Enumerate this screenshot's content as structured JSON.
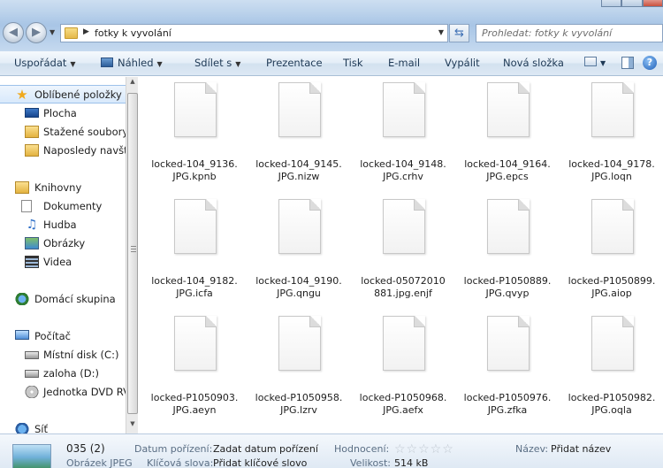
{
  "address": {
    "path": "fotky k vyvolání",
    "search_placeholder": "Prohledat: fotky k vyvolání"
  },
  "toolbar": {
    "organize": "Uspořádat",
    "preview": "Náhled",
    "share": "Sdílet s",
    "slideshow": "Prezentace",
    "print": "Tisk",
    "email": "E-mail",
    "burn": "Vypálit",
    "new_folder": "Nová složka"
  },
  "sidebar": {
    "favorites": "Oblíbené položky",
    "desktop": "Plocha",
    "downloads": "Stažené soubory",
    "recent": "Naposledy navšti",
    "libraries": "Knihovny",
    "documents": "Dokumenty",
    "music": "Hudba",
    "pictures": "Obrázky",
    "videos": "Videa",
    "homegroup": "Domácí skupina",
    "computer": "Počítač",
    "local_disk": "Místní disk (C:)",
    "backup": "zaloha (D:)",
    "dvd": "Jednotka DVD RV",
    "network": "Síť"
  },
  "files": [
    {
      "line1": "locked-104_9136.",
      "line2": "JPG.kpnb"
    },
    {
      "line1": "locked-104_9145.",
      "line2": "JPG.nizw"
    },
    {
      "line1": "locked-104_9148.",
      "line2": "JPG.crhv"
    },
    {
      "line1": "locked-104_9164.",
      "line2": "JPG.epcs"
    },
    {
      "line1": "locked-104_9178.",
      "line2": "JPG.loqn"
    },
    {
      "line1": "locked-104_9182.",
      "line2": "JPG.icfa"
    },
    {
      "line1": "locked-104_9190.",
      "line2": "JPG.qngu"
    },
    {
      "line1": "locked-05072010",
      "line2": "881.jpg.enjf"
    },
    {
      "line1": "locked-P1050889.",
      "line2": "JPG.qvyp"
    },
    {
      "line1": "locked-P1050899.",
      "line2": "JPG.aiop"
    },
    {
      "line1": "locked-P1050903.",
      "line2": "JPG.aeyn"
    },
    {
      "line1": "locked-P1050958.",
      "line2": "JPG.lzrv"
    },
    {
      "line1": "locked-P1050968.",
      "line2": "JPG.aefx"
    },
    {
      "line1": "locked-P1050976.",
      "line2": "JPG.zfka"
    },
    {
      "line1": "locked-P1050982.",
      "line2": "JPG.oqla"
    }
  ],
  "details": {
    "name": "035 (2)",
    "type": "Obrázek JPEG",
    "date_label": "Datum pořízení:",
    "date_value": "Zadat datum pořízení",
    "keywords_label": "Klíčová slova:",
    "keywords_value": "Přidat klíčové slovo",
    "rating_label": "Hodnocení:",
    "rating_stars": "☆☆☆☆☆",
    "size_label": "Velikost:",
    "size_value": "514 kB",
    "title_label": "Název:",
    "title_value": "Přidat název"
  }
}
